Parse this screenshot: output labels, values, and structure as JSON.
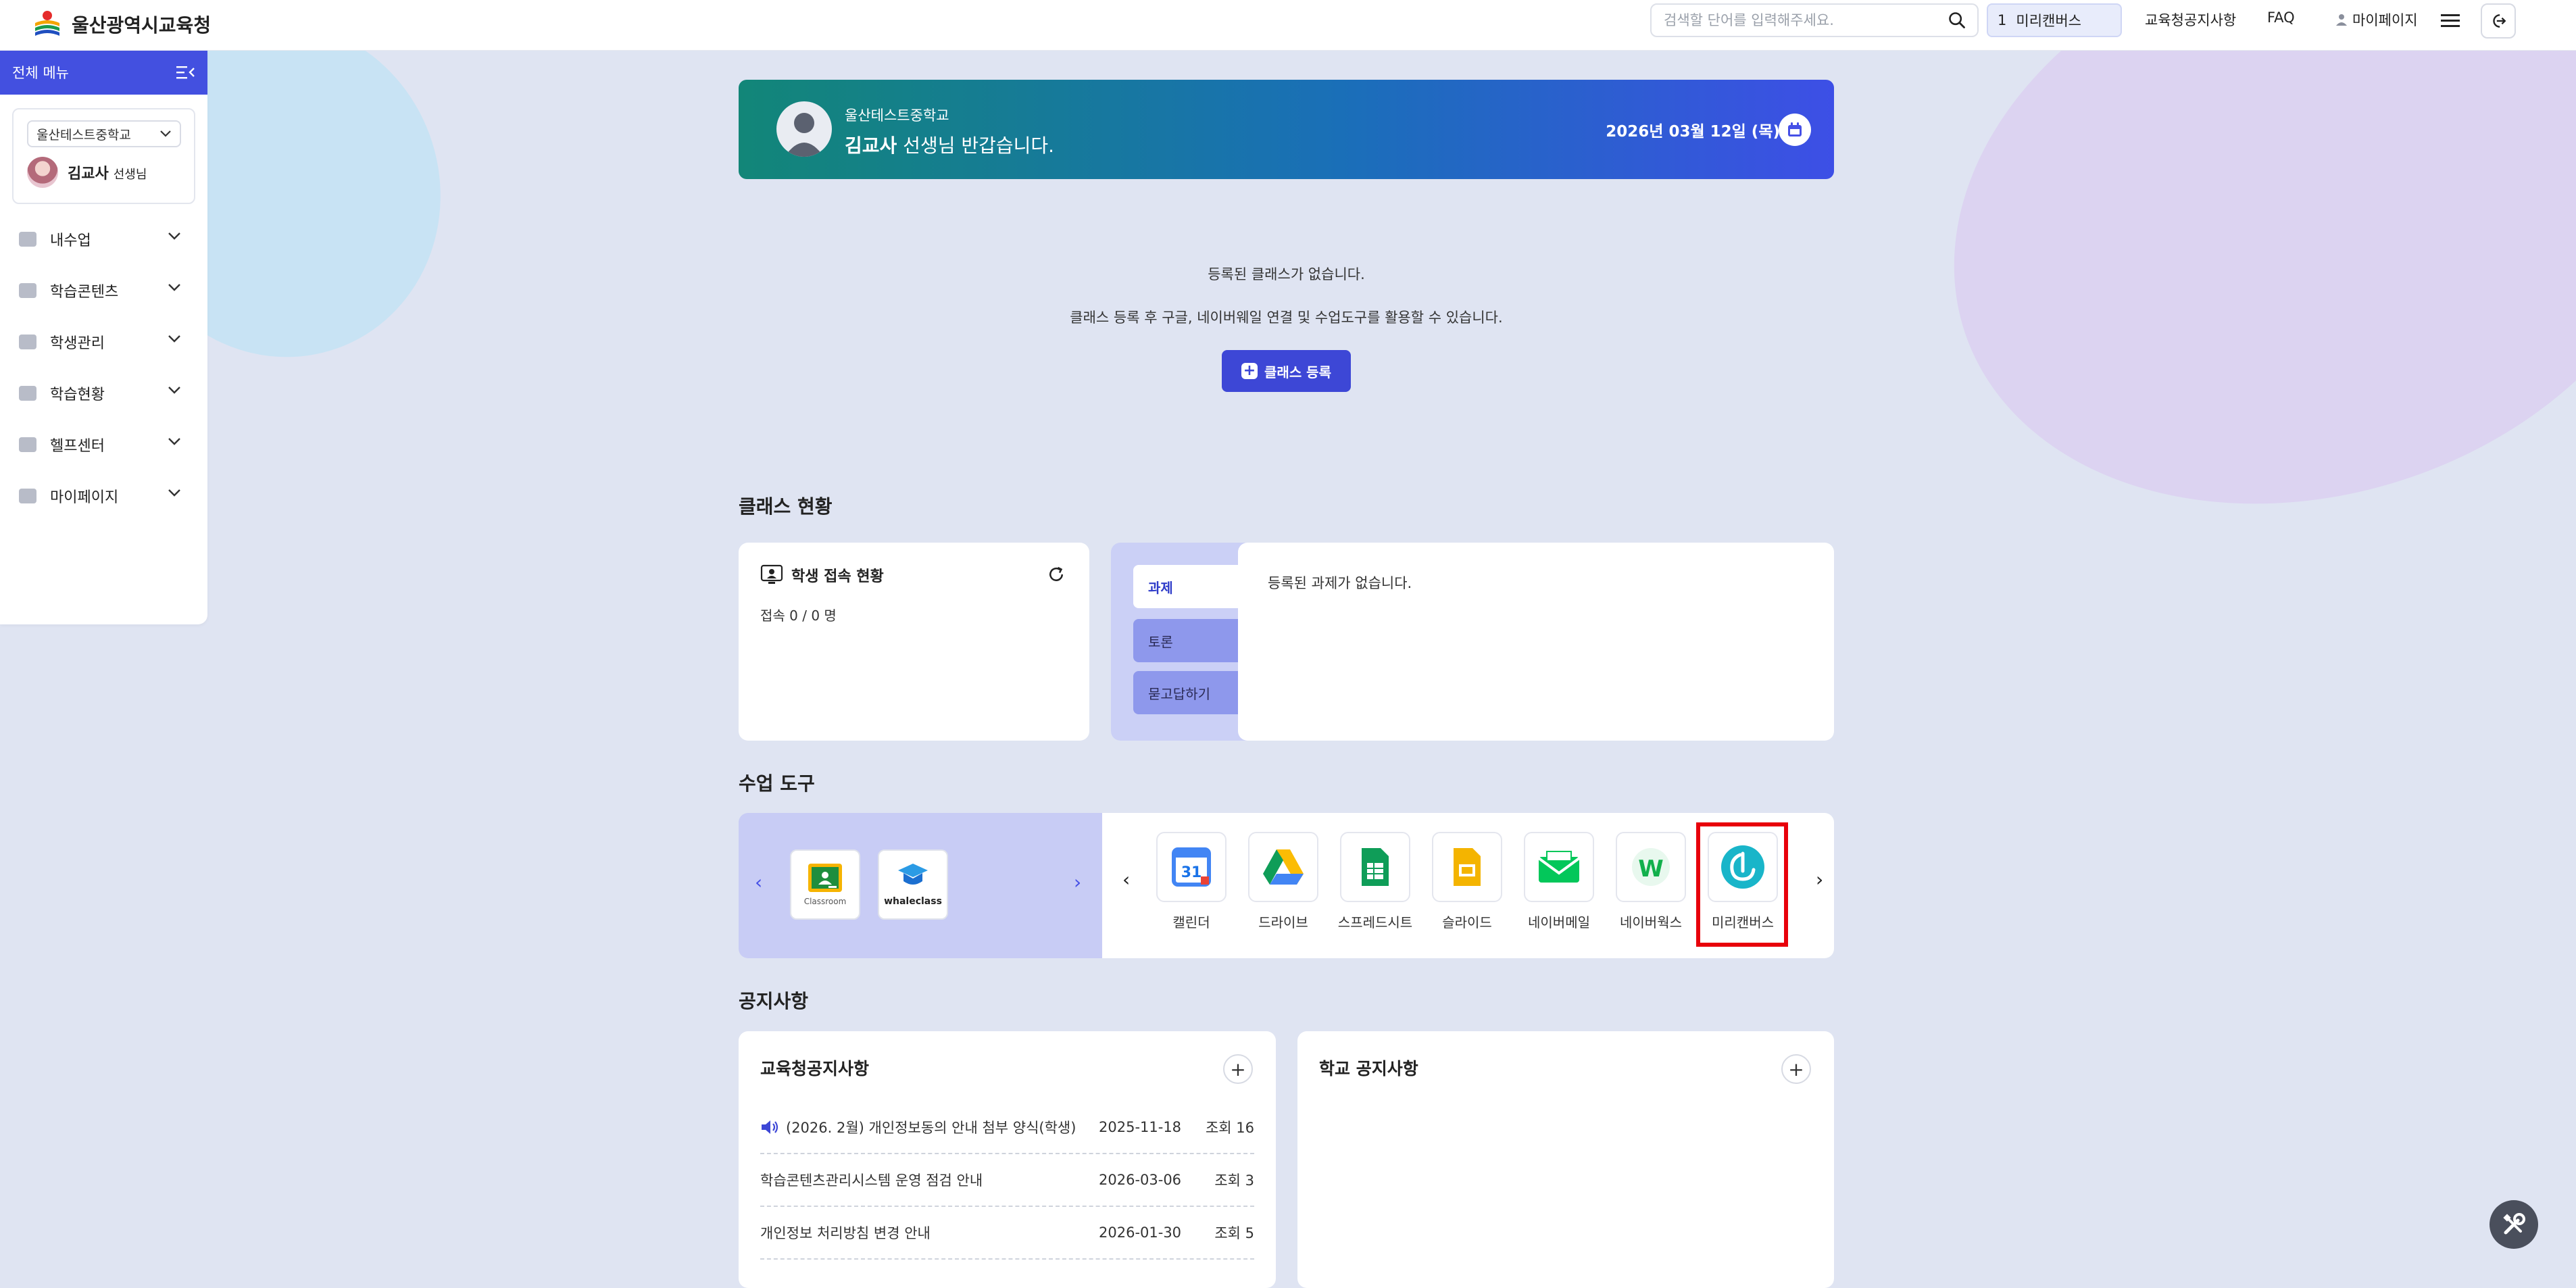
{
  "header": {
    "logo_text": "울산광역시교육청",
    "search_placeholder": "검색할 단어를 입력해주세요.",
    "pill_number": "1",
    "pill_label": "미리캔버스",
    "links": {
      "notice": "교육청공지사항",
      "faq": "FAQ",
      "mypage": "마이페이지"
    }
  },
  "sidebar": {
    "title": "전체 메뉴",
    "school": "울산테스트중학교",
    "user_name": "김교사",
    "user_role": "선생님",
    "items": [
      {
        "label": "내수업"
      },
      {
        "label": "학습콘텐츠"
      },
      {
        "label": "학생관리"
      },
      {
        "label": "학습현황"
      },
      {
        "label": "헬프센터"
      },
      {
        "label": "마이페이지"
      }
    ]
  },
  "banner": {
    "school": "울산테스트중학교",
    "name": "김교사",
    "greeting": " 선생님 반갑습니다.",
    "date": "2026년 03월 12일 (목)"
  },
  "class_empty": {
    "line1": "등록된 클래스가 없습니다.",
    "line2": "클래스 등록 후 구글, 네이버웨일 연결 및 수업도구를 활용할 수 있습니다.",
    "button": "클래스 등록"
  },
  "class_status": {
    "section_title": "클래스 현황",
    "student_title": "학생 접속 현황",
    "student_count": "접속 0 / 0 명",
    "tabs": [
      "과제",
      "토론",
      "묻고답하기"
    ],
    "assign_empty": "등록된 과제가 없습니다."
  },
  "tools": {
    "section_title": "수업 도구",
    "left": [
      {
        "caption": "Classroom",
        "icon": "google-classroom-icon"
      },
      {
        "caption": "whaleclass",
        "icon": "whale-class-icon"
      }
    ],
    "items": [
      {
        "label": "캘린더",
        "icon": "calendar-icon",
        "text": "31"
      },
      {
        "label": "드라이브",
        "icon": "drive-icon"
      },
      {
        "label": "스프레드시트",
        "icon": "sheets-icon"
      },
      {
        "label": "슬라이드",
        "icon": "slides-icon"
      },
      {
        "label": "네이버메일",
        "icon": "naver-mail-icon"
      },
      {
        "label": "네이버웍스",
        "icon": "naver-works-icon",
        "text": "W"
      },
      {
        "label": "미리캔버스",
        "icon": "miricanvas-icon"
      }
    ]
  },
  "notices": {
    "section_title": "공지사항",
    "office": {
      "title": "교육청공지사항",
      "rows": [
        {
          "title": "(2026. 2월) 개인정보동의 안내 첨부 양식(학생)",
          "date": "2025-11-18",
          "views": "조회 16"
        },
        {
          "title": "학습콘텐츠관리시스템 운영 점검 안내",
          "date": "2026-03-06",
          "views": "조회 3"
        },
        {
          "title": "개인정보 처리방침 변경 안내",
          "date": "2026-01-30",
          "views": "조회 5"
        }
      ]
    },
    "school": {
      "title": "학교 공지사항"
    }
  },
  "colors": {
    "primary": "#3d47d6",
    "highlight": "#e8000b",
    "bg": "#dfe4f2"
  }
}
